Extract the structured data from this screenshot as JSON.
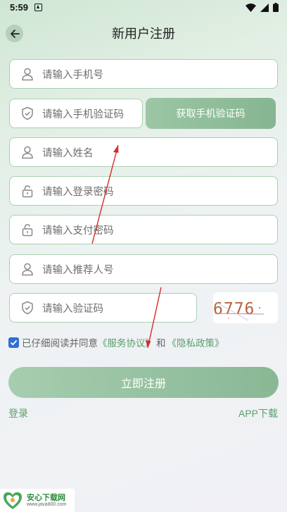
{
  "status_bar": {
    "time": "5:59"
  },
  "header": {
    "title": "新用户注册"
  },
  "form": {
    "phone_placeholder": "请输入手机号",
    "sms_code_placeholder": "请输入手机验证码",
    "get_code_label": "获取手机验证码",
    "name_placeholder": "请输入姓名",
    "login_password_placeholder": "请输入登录密码",
    "pay_password_placeholder": "请输入支付密码",
    "referrer_placeholder": "请输入推荐人号",
    "captcha_placeholder": "请输入验证码",
    "captcha_text": "6776"
  },
  "agreement": {
    "checked": true,
    "prefix": "已仔细阅读并同意",
    "service_link": "《服务协议》",
    "and": "和",
    "privacy_link": "《隐私政策》"
  },
  "register_label": "立即注册",
  "footer": {
    "login_label": "登录",
    "app_download_label": "APP下载"
  },
  "watermark": {
    "name": "安心下载网",
    "url": "www.java800.com"
  },
  "colors": {
    "accent": "#8ab995",
    "link": "#5a9e6c",
    "annotation": "#d62a2a",
    "checkbox": "#2f6fd6"
  },
  "icons": [
    "back-arrow-icon",
    "user-icon",
    "shield-icon",
    "lock-icon",
    "wifi-icon",
    "signal-icon",
    "battery-icon",
    "notification-icon",
    "check-icon"
  ]
}
